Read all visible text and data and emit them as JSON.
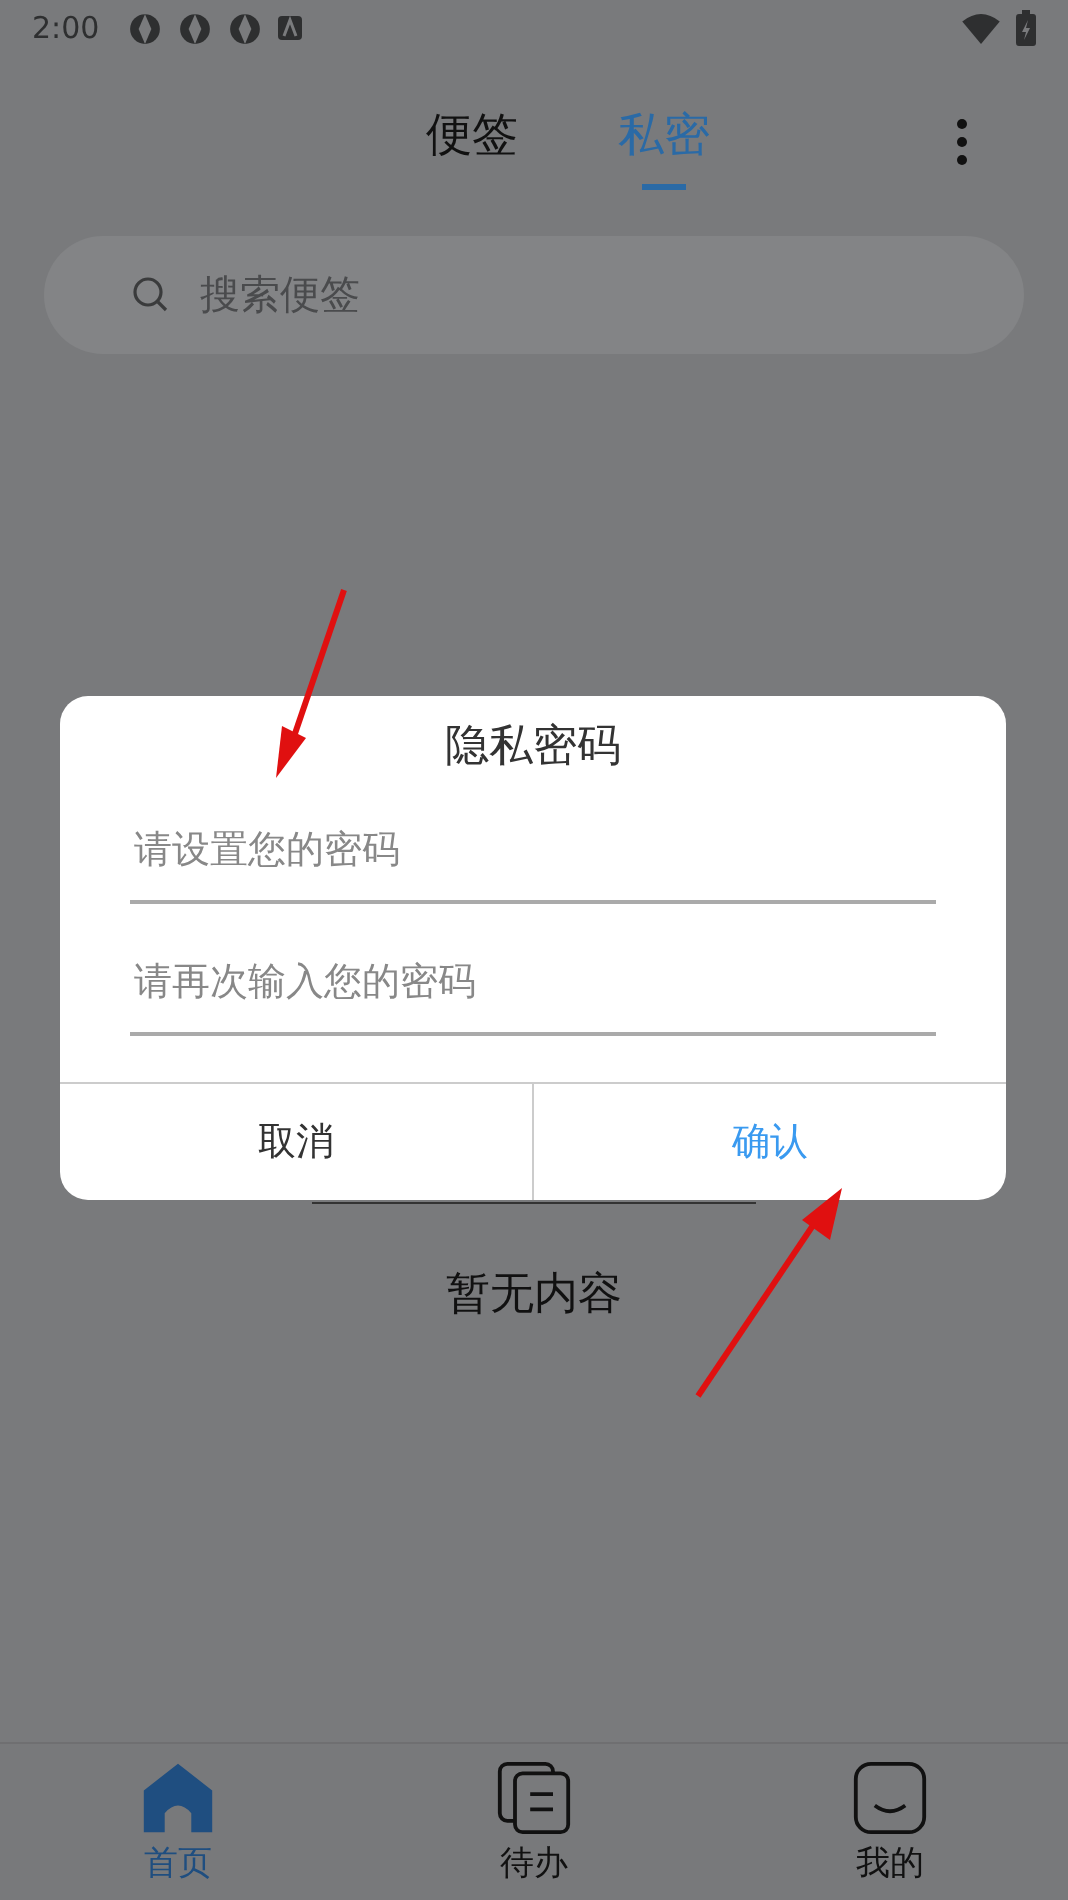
{
  "status_bar": {
    "time": "2:00"
  },
  "tabs": [
    {
      "label": "便签",
      "selected": false
    },
    {
      "label": "私密",
      "selected": true
    }
  ],
  "search": {
    "placeholder": "搜索便签"
  },
  "empty_state": {
    "text": "暂无内容"
  },
  "dialog": {
    "title": "隐私密码",
    "fields": [
      {
        "placeholder": "请设置您的密码"
      },
      {
        "placeholder": "请再次输入您的密码"
      }
    ],
    "buttons": [
      {
        "label": "取消",
        "kind": "cancel"
      },
      {
        "label": "确认",
        "kind": "confirm"
      }
    ]
  },
  "bottom_nav": [
    {
      "label": "首页",
      "kind": "home",
      "selected": true
    },
    {
      "label": "待办",
      "kind": "todo",
      "selected": false
    },
    {
      "label": "我的",
      "kind": "me",
      "selected": false
    }
  ]
}
